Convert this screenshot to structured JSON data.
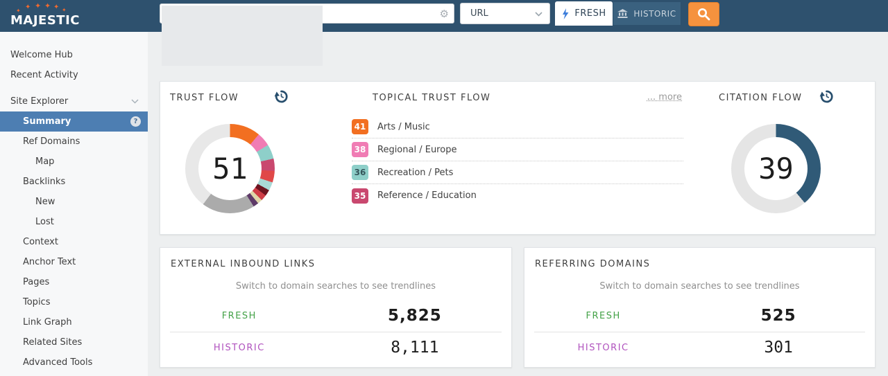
{
  "topbar": {
    "logo_text": "MAJESTIC",
    "search": {
      "value": "",
      "placeholder": ""
    },
    "url_type_selector": "URL",
    "fresh_button_label": "FRESH",
    "historic_button_label": "HISTORIC",
    "colors": {
      "bar": "#2e516e",
      "search_button_orange": "#f5923e",
      "active_tab_white": "#ffffff"
    }
  },
  "sidebar": {
    "items": [
      {
        "label": "Welcome Hub",
        "indent": 0,
        "active": false
      },
      {
        "label": "Recent Activity",
        "indent": 0,
        "active": false
      },
      {
        "label": "Site Explorer",
        "indent": 0,
        "active": false,
        "expandable": true
      },
      {
        "label": "Summary",
        "indent": 1,
        "active": true,
        "help_badge": "?"
      },
      {
        "label": "Ref Domains",
        "indent": 1,
        "active": false
      },
      {
        "label": "Map",
        "indent": 2,
        "active": false
      },
      {
        "label": "Backlinks",
        "indent": 1,
        "active": false
      },
      {
        "label": "New",
        "indent": 2,
        "active": false
      },
      {
        "label": "Lost",
        "indent": 2,
        "active": false
      },
      {
        "label": "Context",
        "indent": 1,
        "active": false
      },
      {
        "label": "Anchor Text",
        "indent": 1,
        "active": false
      },
      {
        "label": "Pages",
        "indent": 1,
        "active": false
      },
      {
        "label": "Topics",
        "indent": 1,
        "active": false
      },
      {
        "label": "Link Graph",
        "indent": 1,
        "active": false
      },
      {
        "label": "Related Sites",
        "indent": 1,
        "active": false
      },
      {
        "label": "Advanced Tools",
        "indent": 1,
        "active": false
      }
    ],
    "active_item_color": "#4d7eb2"
  },
  "chart_data": [
    {
      "type": "donut",
      "title": "TRUST FLOW",
      "value": 51,
      "max": 100,
      "segments": [
        {
          "color": "#f26f21",
          "from": 0,
          "to": 40
        },
        {
          "color": "#f07cb4",
          "from": 40,
          "to": 58
        },
        {
          "color": "#8ecfc9",
          "from": 58,
          "to": 77
        },
        {
          "color": "#c9486f",
          "from": 77,
          "to": 93
        },
        {
          "color": "#e04848",
          "from": 93,
          "to": 108
        },
        {
          "color": "#a9d9d6",
          "from": 108,
          "to": 119
        },
        {
          "color": "#6e1420",
          "from": 119,
          "to": 127
        },
        {
          "color": "#cf3d46",
          "from": 127,
          "to": 135
        },
        {
          "color": "#ded6a9",
          "from": 135,
          "to": 141
        },
        {
          "color": "#5e3a68",
          "from": 141,
          "to": 148
        },
        {
          "color": "#ababab",
          "from": 148,
          "to": 217
        },
        {
          "color": "#e8e8e8",
          "from": 217,
          "to": 360
        }
      ]
    },
    {
      "type": "donut",
      "title": "CITATION FLOW",
      "value": 39,
      "max": 100,
      "segments": [
        {
          "color": "#305a77",
          "from": 0,
          "to": 140
        },
        {
          "color": "#e5e5e5",
          "from": 140,
          "to": 360
        }
      ]
    },
    {
      "type": "list",
      "title": "TOPICAL TRUST FLOW",
      "more_label": "... more",
      "categories": [
        "Arts / Music",
        "Regional / Europe",
        "Recreation / Pets",
        "Reference / Education"
      ],
      "values": [
        41,
        38,
        36,
        35
      ],
      "items": [
        {
          "score": 41,
          "label": "Arts / Music",
          "color": "#f26f21",
          "dark_text": false
        },
        {
          "score": 38,
          "label": "Regional / Europe",
          "color": "#f07cb4",
          "dark_text": false
        },
        {
          "score": 36,
          "label": "Recreation / Pets",
          "color": "#8ecfc9",
          "dark_text": true
        },
        {
          "score": 35,
          "label": "Reference / Education",
          "color": "#c9486f",
          "dark_text": false
        }
      ]
    }
  ],
  "cards": {
    "external_links": {
      "title": "EXTERNAL INBOUND LINKS",
      "note": "Switch to domain searches to see trendlines",
      "fresh_label": "FRESH",
      "fresh_value": "5,825",
      "historic_label": "HISTORIC",
      "historic_value": "8,111"
    },
    "referring_domains": {
      "title": "REFERRING DOMAINS",
      "note": "Switch to domain searches to see trendlines",
      "fresh_label": "FRESH",
      "fresh_value": "525",
      "historic_label": "HISTORIC",
      "historic_value": "301"
    },
    "colors": {
      "fresh_green": "#44a248",
      "historic_purple": "#b052be"
    }
  }
}
